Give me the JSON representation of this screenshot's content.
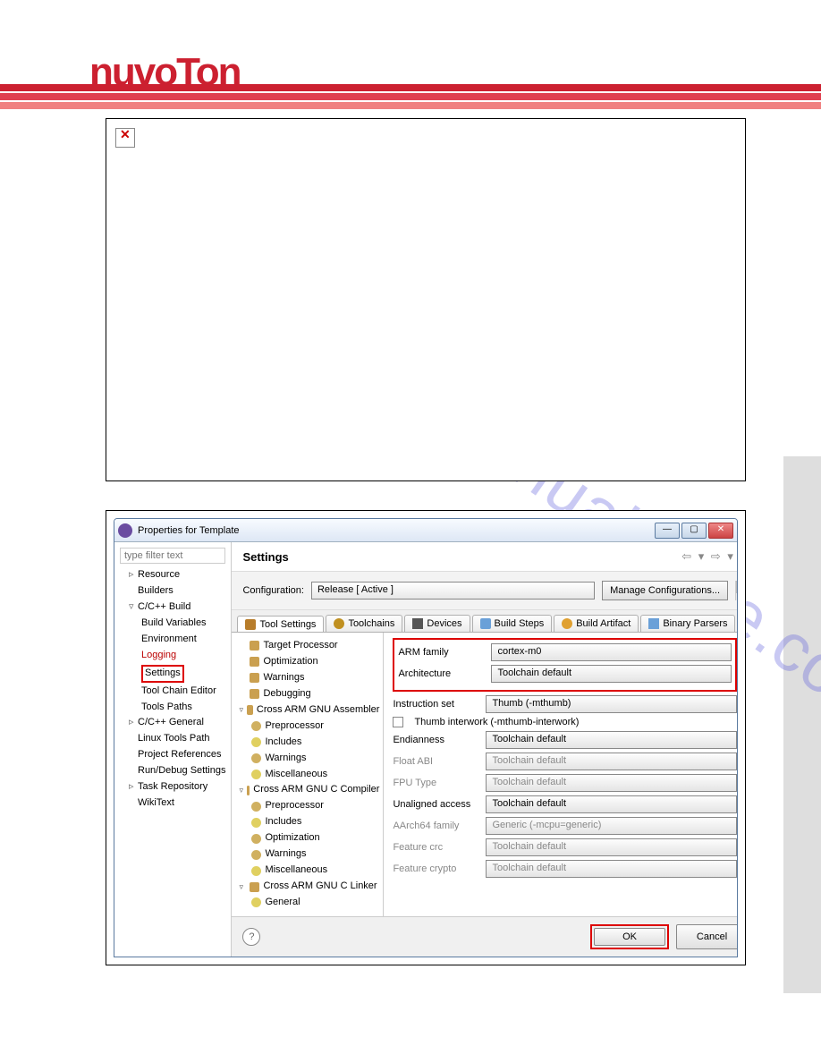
{
  "logo_text": "nuvoTon",
  "watermark_text": "manualshive.com",
  "dialog": {
    "title": "Properties for Template",
    "filter_placeholder": "type filter text",
    "left_tree": {
      "resource": "Resource",
      "builders": "Builders",
      "ccbuild": "C/C++ Build",
      "build_vars": "Build Variables",
      "environment": "Environment",
      "logging": "Logging",
      "settings": "Settings",
      "toolchain_editor": "Tool Chain Editor",
      "tools_paths": "Tools Paths",
      "ccgeneral": "C/C++ General",
      "linux_tools": "Linux Tools Path",
      "proj_refs": "Project References",
      "rundebug": "Run/Debug Settings",
      "task_repo": "Task Repository",
      "wikitext": "WikiText"
    },
    "settings_title": "Settings",
    "config_label": "Configuration:",
    "config_value": "Release  [ Active ]",
    "manage_btn": "Manage Configurations...",
    "tabs": {
      "tool_settings": "Tool Settings",
      "toolchains": "Toolchains",
      "devices": "Devices",
      "build_steps": "Build Steps",
      "build_artifact": "Build Artifact",
      "binary_parsers": "Binary Parsers"
    },
    "tool_tree": {
      "target_proc": "Target Processor",
      "optimization": "Optimization",
      "warnings": "Warnings",
      "debugging": "Debugging",
      "asm": "Cross ARM GNU Assembler",
      "preprocessor": "Preprocessor",
      "includes": "Includes",
      "warnings2": "Warnings",
      "misc": "Miscellaneous",
      "ccomp": "Cross ARM GNU C Compiler",
      "preprocessor2": "Preprocessor",
      "includes2": "Includes",
      "optimization2": "Optimization",
      "warnings3": "Warnings",
      "misc2": "Miscellaneous",
      "clinker": "Cross ARM GNU C Linker",
      "general": "General"
    },
    "form": {
      "arm_family_label": "ARM family",
      "arm_family_value": "cortex-m0",
      "arch_label": "Architecture",
      "arch_value": "Toolchain default",
      "instr_label": "Instruction set",
      "instr_value": "Thumb (-mthumb)",
      "thumb_check": "Thumb interwork (-mthumb-interwork)",
      "endian_label": "Endianness",
      "endian_value": "Toolchain default",
      "float_label": "Float ABI",
      "float_value": "Toolchain default",
      "fpu_label": "FPU Type",
      "fpu_value": "Toolchain default",
      "unalign_label": "Unaligned access",
      "unalign_value": "Toolchain default",
      "aarch_label": "AArch64 family",
      "aarch_value": "Generic (-mcpu=generic)",
      "crc_label": "Feature crc",
      "crc_value": "Toolchain default",
      "crypto_label": "Feature crypto",
      "crypto_value": "Toolchain default"
    },
    "ok_btn": "OK",
    "cancel_btn": "Cancel",
    "help_glyph": "?"
  }
}
